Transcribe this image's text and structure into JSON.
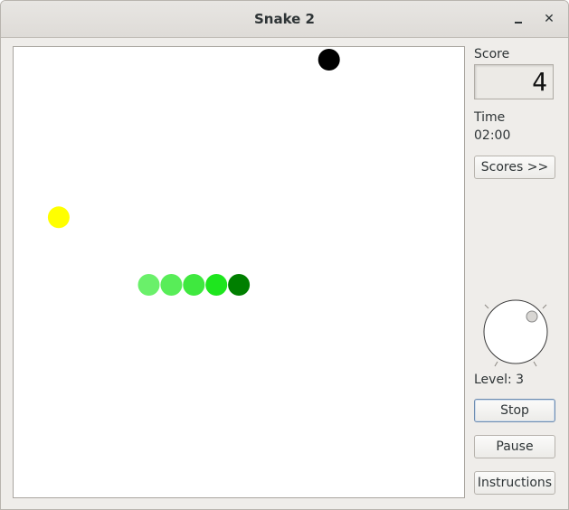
{
  "window": {
    "title": "Snake 2",
    "minimize_glyph": "_",
    "close_glyph": "✕"
  },
  "game": {
    "board_background": "#ffffff",
    "snake": [
      {
        "col": 5,
        "row": 10,
        "color": "#6af06a"
      },
      {
        "col": 6,
        "row": 10,
        "color": "#58ed58"
      },
      {
        "col": 7,
        "row": 10,
        "color": "#3fe83f"
      },
      {
        "col": 8,
        "row": 10,
        "color": "#1ee61e"
      },
      {
        "col": 9,
        "row": 10,
        "color": "#007f00",
        "head": true
      }
    ],
    "food": {
      "col": 1,
      "row": 7,
      "color": "#ffff00"
    },
    "obstacle": {
      "col": 13,
      "row": 0,
      "color": "#000000"
    }
  },
  "sidebar": {
    "score_label": "Score",
    "score_value": "4",
    "time_label": "Time",
    "time_value": "02:00",
    "scores_button": "Scores >>",
    "level_label": "Level: 3",
    "level": 3,
    "stop_button": "Stop",
    "pause_button": "Pause",
    "instructions_button": "Instructions"
  }
}
